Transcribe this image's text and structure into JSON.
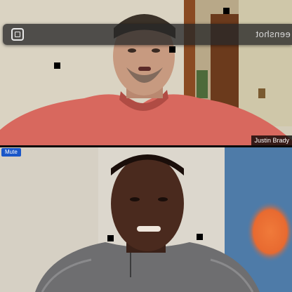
{
  "call": {
    "top_participant": {
      "name": "Justin Brady"
    },
    "bottom_participant": {
      "mute_label": "Mute"
    },
    "overlay": {
      "label": "eenshot",
      "expand_icon": "fullscreen-icon"
    }
  },
  "colors": {
    "mute_badge": "#1a56c8",
    "overlay_bg": "#282828",
    "top_shirt": "#d8685e",
    "bottom_shirt": "#6e6e70"
  }
}
